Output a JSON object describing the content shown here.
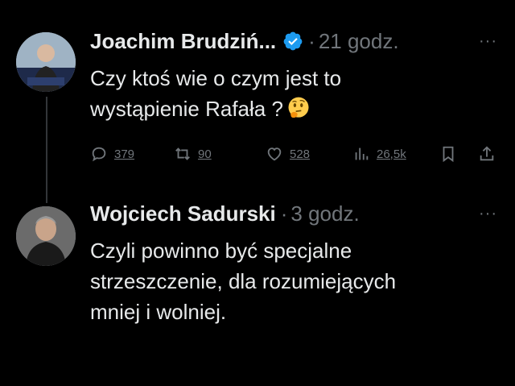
{
  "tweets": [
    {
      "author": "Joachim Brudziń...",
      "time": "21 godz.",
      "separator": "·",
      "more": "···",
      "lines": [
        "Czy ktoś wie o czym jest to",
        "wystąpienie Rafała ?"
      ],
      "emoji_icon": "thinking-face-icon",
      "verified": true,
      "stats": {
        "replies": "379",
        "retweets": "90",
        "likes": "528",
        "views": "26,5k"
      }
    },
    {
      "author": "Wojciech Sadurski",
      "time": "3 godz.",
      "separator": "·",
      "more": "···",
      "lines": [
        "Czyli powinno być specjalne",
        "strzeszczenie, dla rozumiejących",
        "mniej i wolniej."
      ]
    }
  ],
  "colors": {
    "background": "#000000",
    "text": "#e7e9ea",
    "muted": "#71767b",
    "verified": "#1d9bf0"
  }
}
